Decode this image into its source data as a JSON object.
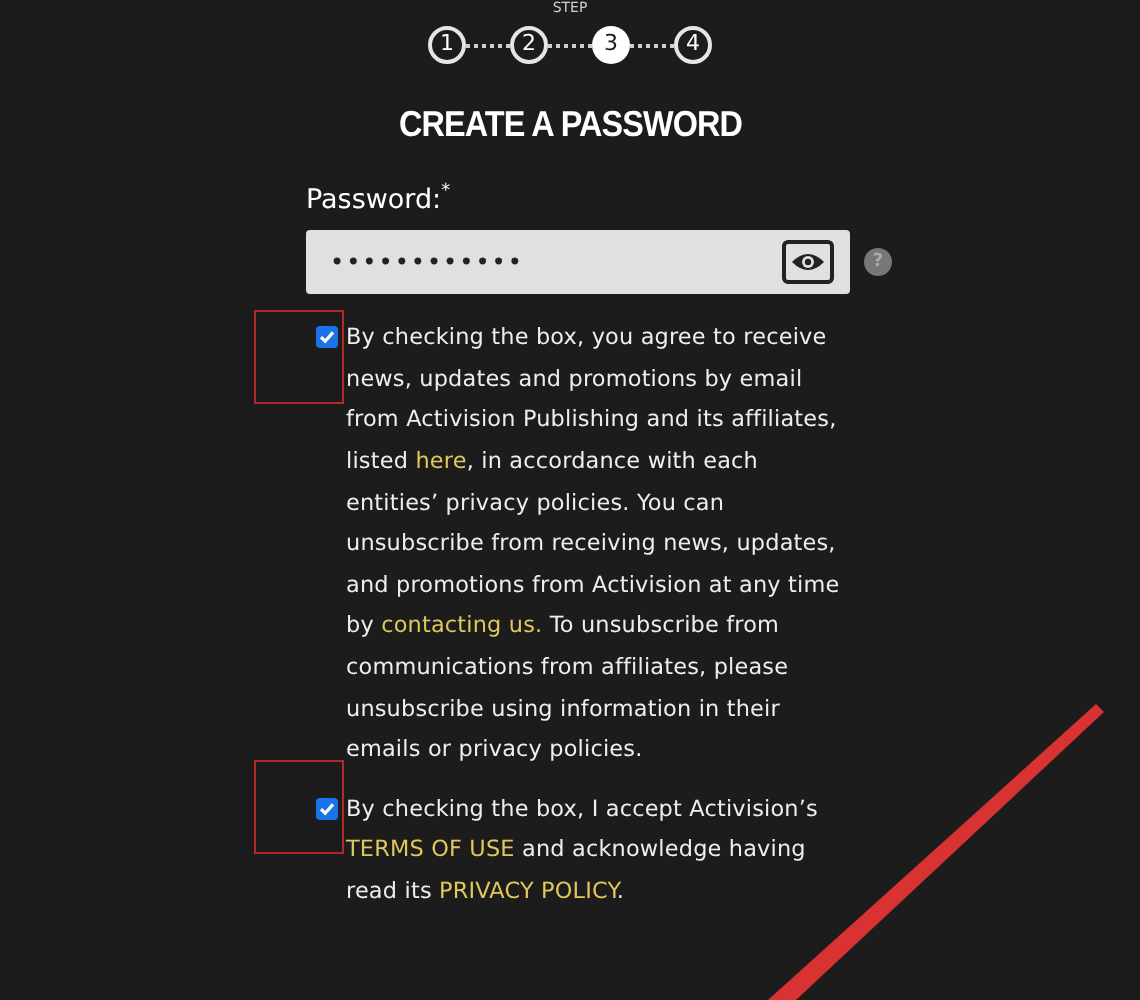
{
  "stepper": {
    "label": "STEP",
    "steps": [
      {
        "label": "1",
        "selected": false
      },
      {
        "label": "2",
        "selected": false
      },
      {
        "label": "3",
        "selected": true
      },
      {
        "label": "4",
        "selected": false
      }
    ]
  },
  "title": "CREATE A PASSWORD",
  "password": {
    "label": "Password:",
    "required_mark": "*",
    "value": "••••••••••••",
    "help": "?"
  },
  "consents": [
    {
      "checked": true,
      "segments": [
        {
          "kind": "text",
          "text": "By checking the box, you agree to receive news, updates and promotions by email from Activision Publishing and its affiliates, listed "
        },
        {
          "kind": "link",
          "text": "here"
        },
        {
          "kind": "text",
          "text": ", in accordance with each entities’ privacy policies. You can unsubscribe from receiving news, updates, and promotions from Activision at any time by "
        },
        {
          "kind": "link",
          "text": "contacting us."
        },
        {
          "kind": "text",
          "text": " To unsubscribe from communications from affiliates, please unsubscribe using information in their emails or privacy policies."
        }
      ]
    },
    {
      "checked": true,
      "segments": [
        {
          "kind": "text",
          "text": "By checking the box, I accept Activision’s "
        },
        {
          "kind": "link",
          "text": "TERMS OF USE"
        },
        {
          "kind": "text",
          "text": " and acknowledge having read its "
        },
        {
          "kind": "link",
          "text": "PRIVACY POLICY"
        },
        {
          "kind": "text",
          "text": "."
        }
      ]
    }
  ]
}
